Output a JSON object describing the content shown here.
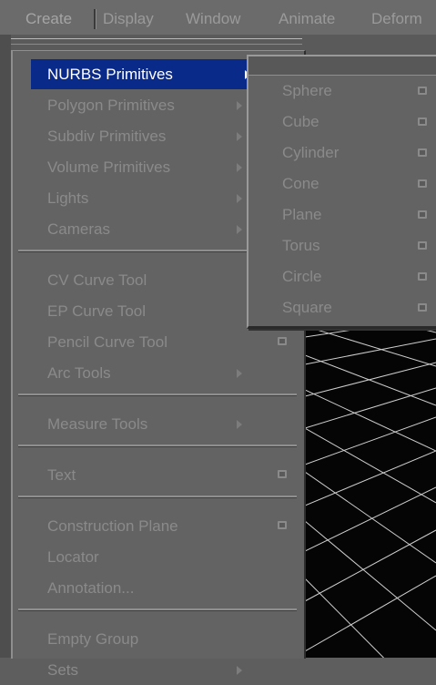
{
  "menubar": {
    "items": [
      {
        "label": "Create",
        "active": true
      },
      {
        "label": "Display"
      },
      {
        "label": "Window"
      },
      {
        "label": "Animate"
      },
      {
        "label": "Deform"
      }
    ]
  },
  "create_menu": {
    "groups": [
      [
        {
          "label": "NURBS Primitives",
          "submenu": true,
          "highlighted": true
        },
        {
          "label": "Polygon Primitives",
          "submenu": true
        },
        {
          "label": "Subdiv Primitives",
          "submenu": true
        },
        {
          "label": "Volume Primitives",
          "submenu": true
        },
        {
          "label": "Lights",
          "submenu": true
        },
        {
          "label": "Cameras",
          "submenu": true
        }
      ],
      [
        {
          "label": "CV Curve Tool",
          "option_box": true
        },
        {
          "label": "EP Curve Tool",
          "option_box": true
        },
        {
          "label": "Pencil Curve Tool",
          "option_box": true
        },
        {
          "label": "Arc Tools",
          "submenu": true
        }
      ],
      [
        {
          "label": "Measure Tools",
          "submenu": true
        }
      ],
      [
        {
          "label": "Text",
          "option_box": true
        }
      ],
      [
        {
          "label": "Construction Plane",
          "option_box": true
        },
        {
          "label": "Locator"
        },
        {
          "label": "Annotation..."
        }
      ],
      [
        {
          "label": "Empty Group"
        },
        {
          "label": "Sets",
          "submenu": true
        }
      ]
    ]
  },
  "nurbs_submenu": {
    "items": [
      {
        "label": "Sphere",
        "option_box": true
      },
      {
        "label": "Cube",
        "option_box": true
      },
      {
        "label": "Cylinder",
        "option_box": true
      },
      {
        "label": "Cone",
        "option_box": true
      },
      {
        "label": "Plane",
        "option_box": true
      },
      {
        "label": "Torus",
        "option_box": true
      },
      {
        "label": "Circle",
        "option_box": true
      },
      {
        "label": "Square",
        "option_box": true
      }
    ]
  },
  "colors": {
    "highlight": "#0a2a8a",
    "menu_bg": "#636363",
    "text_disabled": "#8a8a8a",
    "viewport_bg": "#050505"
  },
  "icons": {
    "submenu_arrow": "triangle-right-icon",
    "option_box": "option-box-icon"
  }
}
